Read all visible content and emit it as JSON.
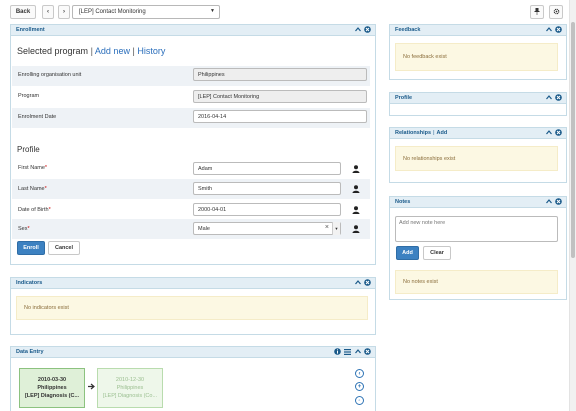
{
  "toolbar": {
    "back_label": "Back",
    "program_selected": "[LEP] Contact Monitoring"
  },
  "enrollment": {
    "title": "Enrollment",
    "heading_selected": "Selected program",
    "link_add_new": "Add new",
    "link_history": "History",
    "separator": "|",
    "fields": {
      "org_unit": {
        "label": "Enrolling organisation unit",
        "value": "Philippines"
      },
      "program": {
        "label": "Program",
        "value": "[LEP] Contact Monitoring"
      },
      "date": {
        "label": "Enrolment Date",
        "value": "2016-04-14"
      }
    },
    "profile_title": "Profile",
    "profile": {
      "first_name": {
        "label": "First Name",
        "value": "Adam"
      },
      "last_name": {
        "label": "Last Name",
        "value": "Smith"
      },
      "dob": {
        "label": "Date of Birth",
        "value": "2000-04-01"
      },
      "sex": {
        "label": "Sex",
        "value": "Male",
        "clear": "×"
      }
    },
    "required_mark": "*",
    "enroll_label": "Enroll",
    "cancel_label": "Cancel"
  },
  "indicators": {
    "title": "Indicators",
    "empty": "No indicators exist"
  },
  "data_entry": {
    "title": "Data Entry",
    "events": [
      {
        "date": "2010-03-30",
        "org": "Philippines",
        "stage": "[LEP] Diagnosis (C..."
      },
      {
        "date": "2010-12-30",
        "org": "Philippines",
        "stage": "[LEP] Diagnosis (Co..."
      }
    ]
  },
  "feedback": {
    "title": "Feedback",
    "empty": "No feedback exist"
  },
  "profile_widget": {
    "title": "Profile"
  },
  "relationships": {
    "title": "Relationships",
    "add_link": "Add",
    "separator": "|",
    "empty": "No relationships exist"
  },
  "notes": {
    "title": "Notes",
    "placeholder": "Add new note here",
    "add_label": "Add",
    "clear_label": "Clear",
    "empty": "No notes exist"
  },
  "colors": {
    "header_bg": "#e3eef5",
    "header_text": "#1a5a8a",
    "primary": "#3c81c1",
    "warning_bg": "#fcf8e3",
    "event_green": "#dff0d8"
  }
}
